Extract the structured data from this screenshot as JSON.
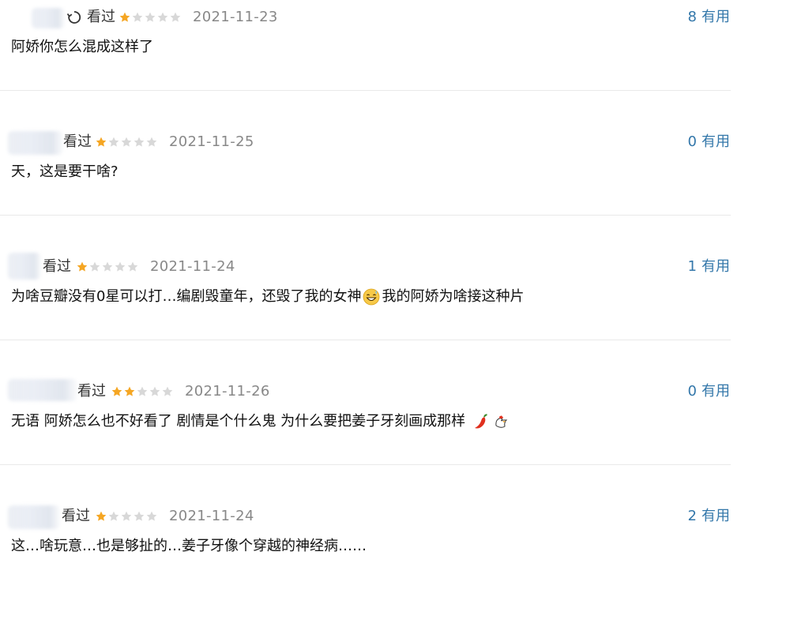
{
  "colors": {
    "star_filled": "#f5a623",
    "star_empty": "#d8d8d8",
    "useful_link": "#3377aa",
    "date": "#888888",
    "divider": "#e9e9e9"
  },
  "reviews": [
    {
      "status": "看过",
      "rating": 1,
      "date": "2021-11-23",
      "useful_count": "8",
      "useful_label": "有用",
      "content": "阿娇你怎么混成这样了"
    },
    {
      "status": "看过",
      "rating": 1,
      "date": "2021-11-25",
      "useful_count": "0",
      "useful_label": "有用",
      "content": "天，这是要干啥?"
    },
    {
      "status": "看过",
      "rating": 1,
      "date": "2021-11-24",
      "useful_count": "1",
      "useful_label": "有用",
      "content_before_emoji": "为啥豆瓣没有0星可以打…编剧毁童年，还毁了我的女神",
      "content_after_emoji": "我的阿娇为啥接这种片",
      "emoji": "grinning-sweat-emoji"
    },
    {
      "status": "看过",
      "rating": 2,
      "date": "2021-11-26",
      "useful_count": "0",
      "useful_label": "有用",
      "content": "无语 阿娇怎么也不好看了 剧情是个什么鬼 为什么要把姜子牙刻画成那样",
      "emojis": [
        "chili-pepper-emoji",
        "rooster-emoji"
      ]
    },
    {
      "status": "看过",
      "rating": 1,
      "date": "2021-11-24",
      "useful_count": "2",
      "useful_label": "有用",
      "content": "这…啥玩意…也是够扯的…姜子牙像个穿越的神经病……"
    }
  ]
}
